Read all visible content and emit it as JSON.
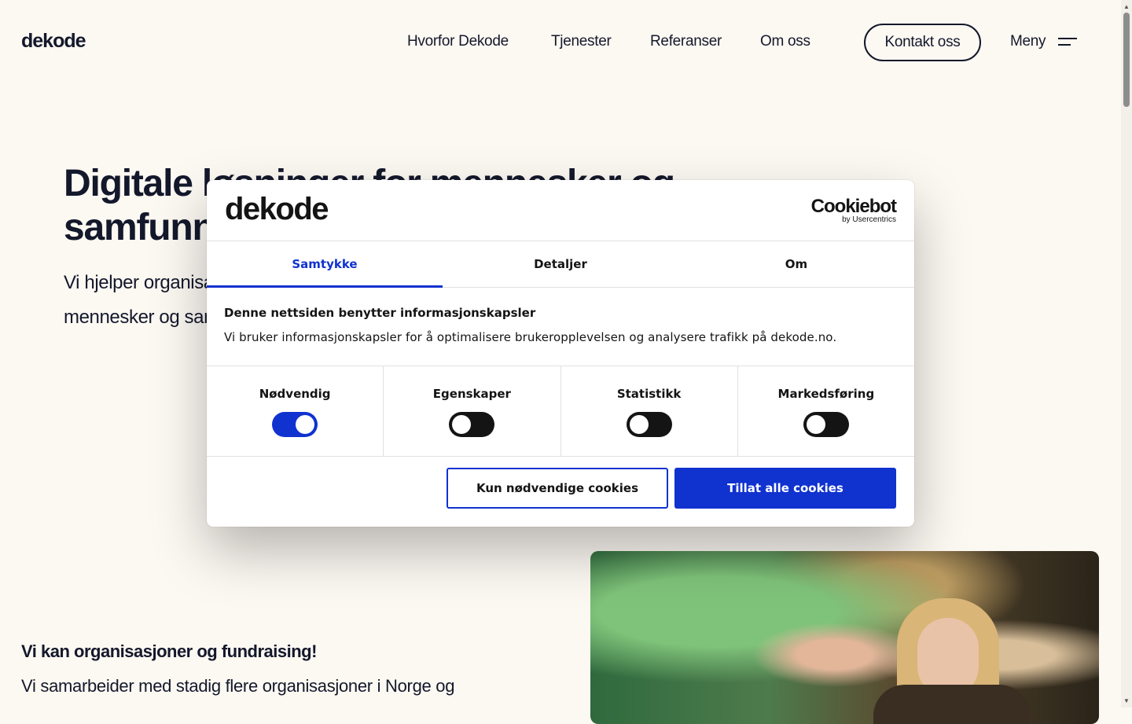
{
  "header": {
    "logo": "dekode",
    "nav": [
      {
        "label": "Hvorfor Dekode"
      },
      {
        "label": "Tjenester"
      },
      {
        "label": "Referanser"
      },
      {
        "label": "Om oss"
      }
    ],
    "contact_label": "Kontakt oss",
    "menu_label": "Meny"
  },
  "hero": {
    "title": "Digitale løsninger for mennesker og samfunn",
    "subtitle": "Vi hjelper organisasjoner med å ta i bruk teknologi, men for å skape verdi for mennesker og samfunn må teknologi bygges"
  },
  "section": {
    "title": "Vi kan organisasjoner og fundraising!",
    "text": "Vi samarbeider med stadig flere organisasjoner i Norge og"
  },
  "cookie_dialog": {
    "logo": "dekode",
    "provider": "Cookiebot",
    "provider_sub": "by Usercentrics",
    "tabs": [
      {
        "label": "Samtykke",
        "active": true
      },
      {
        "label": "Detaljer",
        "active": false
      },
      {
        "label": "Om",
        "active": false
      }
    ],
    "heading": "Denne nettsiden benytter informasjonskapsler",
    "text": "Vi bruker informasjonskapsler for å optimalisere brukeropplevelsen og analysere trafikk på dekode.no.",
    "categories": [
      {
        "label": "Nødvendig",
        "enabled": true
      },
      {
        "label": "Egenskaper",
        "enabled": false
      },
      {
        "label": "Statistikk",
        "enabled": false
      },
      {
        "label": "Markedsføring",
        "enabled": false
      }
    ],
    "btn_necessary": "Kun nødvendige cookies",
    "btn_allow_all": "Tillat alle cookies"
  },
  "colors": {
    "background": "#fcf8f2",
    "text": "#13182b",
    "accent": "#1032cf"
  }
}
